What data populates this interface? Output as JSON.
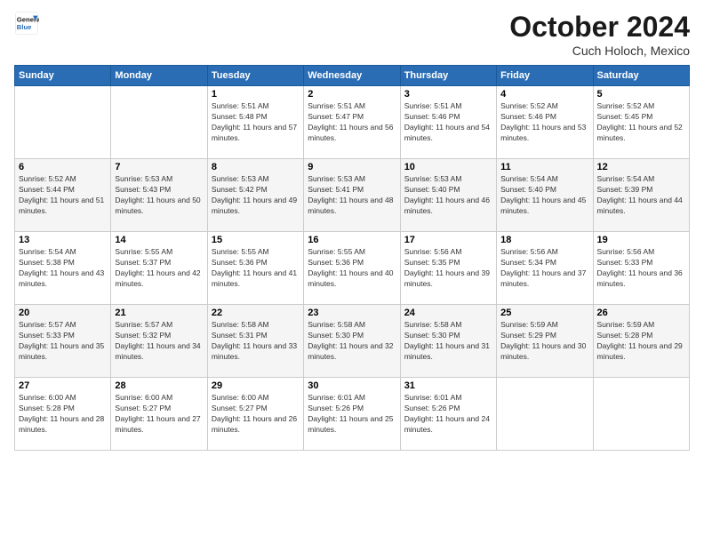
{
  "logo": {
    "line1": "General",
    "line2": "Blue"
  },
  "title": "October 2024",
  "subtitle": "Cuch Holoch, Mexico",
  "days_of_week": [
    "Sunday",
    "Monday",
    "Tuesday",
    "Wednesday",
    "Thursday",
    "Friday",
    "Saturday"
  ],
  "weeks": [
    [
      {
        "day": "",
        "info": ""
      },
      {
        "day": "",
        "info": ""
      },
      {
        "day": "1",
        "info": "Sunrise: 5:51 AM\nSunset: 5:48 PM\nDaylight: 11 hours and 57 minutes."
      },
      {
        "day": "2",
        "info": "Sunrise: 5:51 AM\nSunset: 5:47 PM\nDaylight: 11 hours and 56 minutes."
      },
      {
        "day": "3",
        "info": "Sunrise: 5:51 AM\nSunset: 5:46 PM\nDaylight: 11 hours and 54 minutes."
      },
      {
        "day": "4",
        "info": "Sunrise: 5:52 AM\nSunset: 5:46 PM\nDaylight: 11 hours and 53 minutes."
      },
      {
        "day": "5",
        "info": "Sunrise: 5:52 AM\nSunset: 5:45 PM\nDaylight: 11 hours and 52 minutes."
      }
    ],
    [
      {
        "day": "6",
        "info": "Sunrise: 5:52 AM\nSunset: 5:44 PM\nDaylight: 11 hours and 51 minutes."
      },
      {
        "day": "7",
        "info": "Sunrise: 5:53 AM\nSunset: 5:43 PM\nDaylight: 11 hours and 50 minutes."
      },
      {
        "day": "8",
        "info": "Sunrise: 5:53 AM\nSunset: 5:42 PM\nDaylight: 11 hours and 49 minutes."
      },
      {
        "day": "9",
        "info": "Sunrise: 5:53 AM\nSunset: 5:41 PM\nDaylight: 11 hours and 48 minutes."
      },
      {
        "day": "10",
        "info": "Sunrise: 5:53 AM\nSunset: 5:40 PM\nDaylight: 11 hours and 46 minutes."
      },
      {
        "day": "11",
        "info": "Sunrise: 5:54 AM\nSunset: 5:40 PM\nDaylight: 11 hours and 45 minutes."
      },
      {
        "day": "12",
        "info": "Sunrise: 5:54 AM\nSunset: 5:39 PM\nDaylight: 11 hours and 44 minutes."
      }
    ],
    [
      {
        "day": "13",
        "info": "Sunrise: 5:54 AM\nSunset: 5:38 PM\nDaylight: 11 hours and 43 minutes."
      },
      {
        "day": "14",
        "info": "Sunrise: 5:55 AM\nSunset: 5:37 PM\nDaylight: 11 hours and 42 minutes."
      },
      {
        "day": "15",
        "info": "Sunrise: 5:55 AM\nSunset: 5:36 PM\nDaylight: 11 hours and 41 minutes."
      },
      {
        "day": "16",
        "info": "Sunrise: 5:55 AM\nSunset: 5:36 PM\nDaylight: 11 hours and 40 minutes."
      },
      {
        "day": "17",
        "info": "Sunrise: 5:56 AM\nSunset: 5:35 PM\nDaylight: 11 hours and 39 minutes."
      },
      {
        "day": "18",
        "info": "Sunrise: 5:56 AM\nSunset: 5:34 PM\nDaylight: 11 hours and 37 minutes."
      },
      {
        "day": "19",
        "info": "Sunrise: 5:56 AM\nSunset: 5:33 PM\nDaylight: 11 hours and 36 minutes."
      }
    ],
    [
      {
        "day": "20",
        "info": "Sunrise: 5:57 AM\nSunset: 5:33 PM\nDaylight: 11 hours and 35 minutes."
      },
      {
        "day": "21",
        "info": "Sunrise: 5:57 AM\nSunset: 5:32 PM\nDaylight: 11 hours and 34 minutes."
      },
      {
        "day": "22",
        "info": "Sunrise: 5:58 AM\nSunset: 5:31 PM\nDaylight: 11 hours and 33 minutes."
      },
      {
        "day": "23",
        "info": "Sunrise: 5:58 AM\nSunset: 5:30 PM\nDaylight: 11 hours and 32 minutes."
      },
      {
        "day": "24",
        "info": "Sunrise: 5:58 AM\nSunset: 5:30 PM\nDaylight: 11 hours and 31 minutes."
      },
      {
        "day": "25",
        "info": "Sunrise: 5:59 AM\nSunset: 5:29 PM\nDaylight: 11 hours and 30 minutes."
      },
      {
        "day": "26",
        "info": "Sunrise: 5:59 AM\nSunset: 5:28 PM\nDaylight: 11 hours and 29 minutes."
      }
    ],
    [
      {
        "day": "27",
        "info": "Sunrise: 6:00 AM\nSunset: 5:28 PM\nDaylight: 11 hours and 28 minutes."
      },
      {
        "day": "28",
        "info": "Sunrise: 6:00 AM\nSunset: 5:27 PM\nDaylight: 11 hours and 27 minutes."
      },
      {
        "day": "29",
        "info": "Sunrise: 6:00 AM\nSunset: 5:27 PM\nDaylight: 11 hours and 26 minutes."
      },
      {
        "day": "30",
        "info": "Sunrise: 6:01 AM\nSunset: 5:26 PM\nDaylight: 11 hours and 25 minutes."
      },
      {
        "day": "31",
        "info": "Sunrise: 6:01 AM\nSunset: 5:26 PM\nDaylight: 11 hours and 24 minutes."
      },
      {
        "day": "",
        "info": ""
      },
      {
        "day": "",
        "info": ""
      }
    ]
  ]
}
